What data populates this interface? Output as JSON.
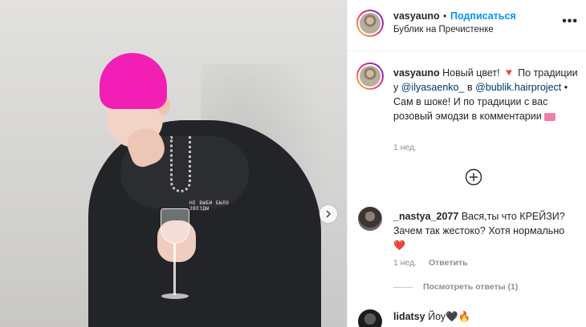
{
  "post": {
    "username": "vasyauno",
    "dot": "•",
    "follow_label": "Подписаться",
    "location": "Бублик на Пречистенке",
    "more_label": "•••",
    "hoodie_print": "НЕ ВЫБИ БЫЛО ЗВЕЗДЫ"
  },
  "caption": {
    "username": "vasyauno",
    "text_1": "Новый цвет!",
    "emoji_1": "🔻",
    "text_2": "По традиции у",
    "mention_1": "@ilyasaenko_",
    "text_3": "в",
    "mention_2": "@bublik.hairproject",
    "text_4": "• Сам в шоке! И по традиции с вас розовый эмодзи в комментарии",
    "emoji_2": "�now",
    "age": "1 нед."
  },
  "comments": [
    {
      "username": "_nastya_2077",
      "text": "Вася,ты что КРЕЙЗИ? Зачем так жестоко? Хотя нормально",
      "emoji": "❤️",
      "age": "1 нед.",
      "reply_label": "Ответить",
      "view_replies": "Посмотреть ответы (1)"
    },
    {
      "username": "lidatsy",
      "text": "Йоу",
      "emoji_1": "🖤",
      "emoji_2": "🔥"
    }
  ],
  "icons": {
    "next": "chevron-right-icon",
    "load_more": "plus-circle-icon",
    "options": "more-horizontal-icon"
  },
  "colors": {
    "link_blue": "#0095f6",
    "mention_blue": "#00376b",
    "secondary_text": "#8e8e8e",
    "hair_pink": "#f21fb4"
  }
}
